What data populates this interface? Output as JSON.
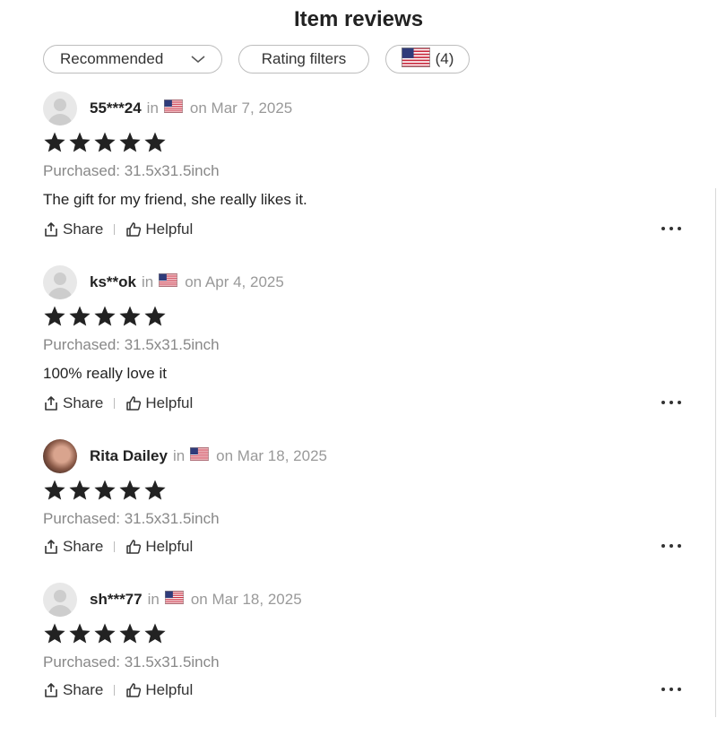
{
  "page": {
    "title": "Item reviews"
  },
  "filters": {
    "sort_label": "Recommended",
    "rating_label": "Rating filters",
    "country_count": "(4)",
    "country_flag_icon": "us-flag-icon"
  },
  "reviews": [
    {
      "user": "55***24",
      "in": "in",
      "flag_icon": "us-flag-icon",
      "date": "on Mar 7, 2025",
      "rating": 5,
      "purchased": "Purchased: 31.5x31.5inch",
      "text": "The gift for my friend, she really likes it.",
      "avatar": "placeholder"
    },
    {
      "user": "ks**ok",
      "in": "in",
      "flag_icon": "us-flag-icon",
      "date": "on Apr 4, 2025",
      "rating": 5,
      "purchased": "Purchased: 31.5x31.5inch",
      "text": "100% really love it",
      "avatar": "placeholder"
    },
    {
      "user": "Rita Dailey",
      "in": "in",
      "flag_icon": "us-flag-icon",
      "date": "on Mar 18, 2025",
      "rating": 5,
      "purchased": "Purchased: 31.5x31.5inch",
      "text": "",
      "avatar": "photo"
    },
    {
      "user": "sh***77",
      "in": "in",
      "flag_icon": "us-flag-icon",
      "date": "on Mar 18, 2025",
      "rating": 5,
      "purchased": "Purchased: 31.5x31.5inch",
      "text": "",
      "avatar": "placeholder"
    }
  ],
  "actions": {
    "share_label": "Share",
    "helpful_label": "Helpful"
  },
  "colors": {
    "text": "#222222",
    "muted": "#999999",
    "star": "#222222",
    "border": "#bdbdbd"
  }
}
